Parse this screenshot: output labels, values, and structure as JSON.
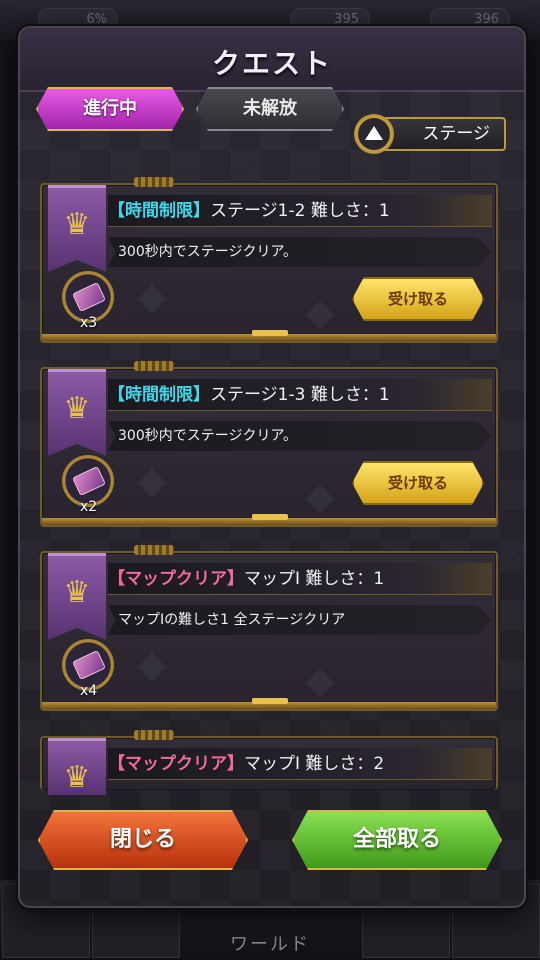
{
  "header": {
    "title": "クエスト"
  },
  "tabs": [
    {
      "label": "進行中",
      "active": true
    },
    {
      "label": "未解放",
      "active": false
    }
  ],
  "sort": {
    "label": "ステージ",
    "direction": "up"
  },
  "quests": [
    {
      "category": "【時間制限】",
      "category_color": "#3fd8e8",
      "title": "ステージ1-2 難しさ：1",
      "description": "300秒内でステージクリア。",
      "reward_count": "x3",
      "claim_label": "受け取る"
    },
    {
      "category": "【時間制限】",
      "category_color": "#3fd8e8",
      "title": "ステージ1-3 難しさ：1",
      "description": "300秒内でステージクリア。",
      "reward_count": "x2",
      "claim_label": "受け取る"
    },
    {
      "category": "【マップクリア】",
      "category_color": "#f06a9a",
      "title": "マップⅠ 難しさ：1",
      "description": "マップⅠの難しさ1 全ステージクリア",
      "reward_count": "x4",
      "claim_label": ""
    },
    {
      "category": "【マップクリア】",
      "category_color": "#f06a9a",
      "title": "マップⅠ 難しさ：2",
      "description": "",
      "reward_count": "",
      "claim_label": ""
    }
  ],
  "footer": {
    "close_label": "閉じる",
    "claim_all_label": "全部取る"
  },
  "background": {
    "hud_values": [
      "6%",
      "395",
      "396"
    ],
    "bottom_label": "ワールド"
  }
}
